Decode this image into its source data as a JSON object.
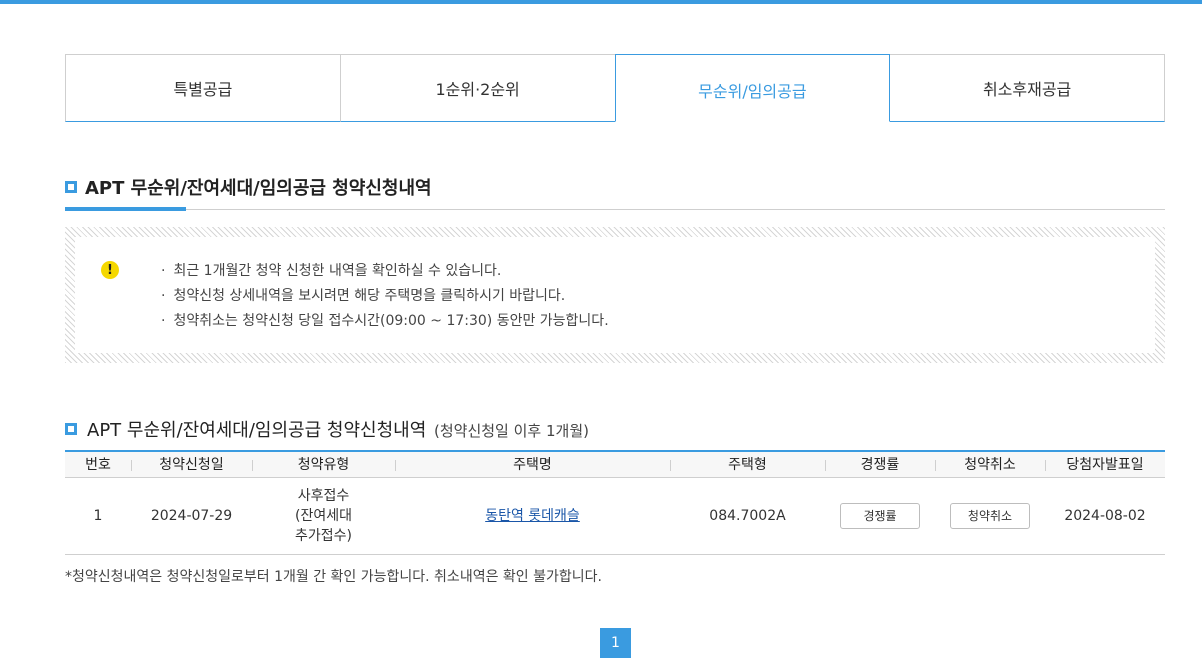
{
  "colors": {
    "accent": "#3a9be0",
    "link": "#1a56a8",
    "warning": "#f5d800"
  },
  "tabs": [
    {
      "label": "특별공급",
      "active": false
    },
    {
      "label": "1순위·2순위",
      "active": false
    },
    {
      "label": "무순위/임의공급",
      "active": true
    },
    {
      "label": "취소후재공급",
      "active": false
    }
  ],
  "section1": {
    "title": "APT 무순위/잔여세대/임의공급 청약신청내역"
  },
  "notice": {
    "icon": "exclamation-icon",
    "items": [
      "최근 1개월간 청약 신청한 내역을 확인하실 수 있습니다.",
      "청약신청 상세내역을 보시려면 해당 주택명을 클릭하시기 바랍니다.",
      "청약취소는 청약신청 당일 접수시간(09:00 ~ 17:30) 동안만 가능합니다."
    ]
  },
  "section2": {
    "title": "APT 무순위/잔여세대/임의공급 청약신청내역",
    "subtitle": "(청약신청일 이후 1개월)"
  },
  "table": {
    "headers": [
      "번호",
      "청약신청일",
      "청약유형",
      "주택명",
      "주택형",
      "경쟁률",
      "청약취소",
      "당첨자발표일"
    ],
    "rows": [
      {
        "no": "1",
        "apply_date": "2024-07-29",
        "type_lines": [
          "사후접수",
          "(잔여세대",
          "추가접수)"
        ],
        "house_name": "동탄역 롯데캐슬",
        "house_type": "084.7002A",
        "rate_button": "경쟁률",
        "cancel_button": "청약취소",
        "announce_date": "2024-08-02"
      }
    ]
  },
  "footnote": "*청약신청내역은 청약신청일로부터 1개월 간 확인 가능합니다. 취소내역은 확인 불가합니다.",
  "pagination": {
    "current": "1"
  }
}
